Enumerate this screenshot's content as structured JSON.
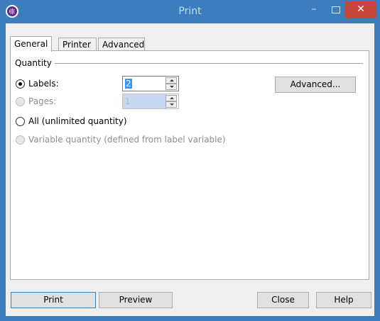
{
  "window": {
    "title": "Print",
    "minimize_glyph": "–",
    "close_glyph": "✕"
  },
  "tabs": [
    {
      "label": "General",
      "active": true
    },
    {
      "label": "Printer",
      "active": false
    },
    {
      "label": "Advanced",
      "active": false
    }
  ],
  "quantity": {
    "group_label": "Quantity",
    "labels_option": {
      "label": "Labels:",
      "checked": true,
      "enabled": true,
      "value": "2"
    },
    "pages_option": {
      "label": "Pages:",
      "checked": false,
      "enabled": false,
      "value": "1"
    },
    "all_option": {
      "label": "All (unlimited quantity)",
      "checked": false,
      "enabled": true
    },
    "variable_option": {
      "label": "Variable quantity (defined from label variable)",
      "checked": false,
      "enabled": false
    },
    "advanced_button": "Advanced..."
  },
  "footer": {
    "print": "Print",
    "preview": "Preview",
    "close": "Close",
    "help": "Help"
  },
  "colors": {
    "titlebar": "#3b7dbd",
    "close_button": "#c7463a",
    "app_icon": "#5b2b84"
  }
}
